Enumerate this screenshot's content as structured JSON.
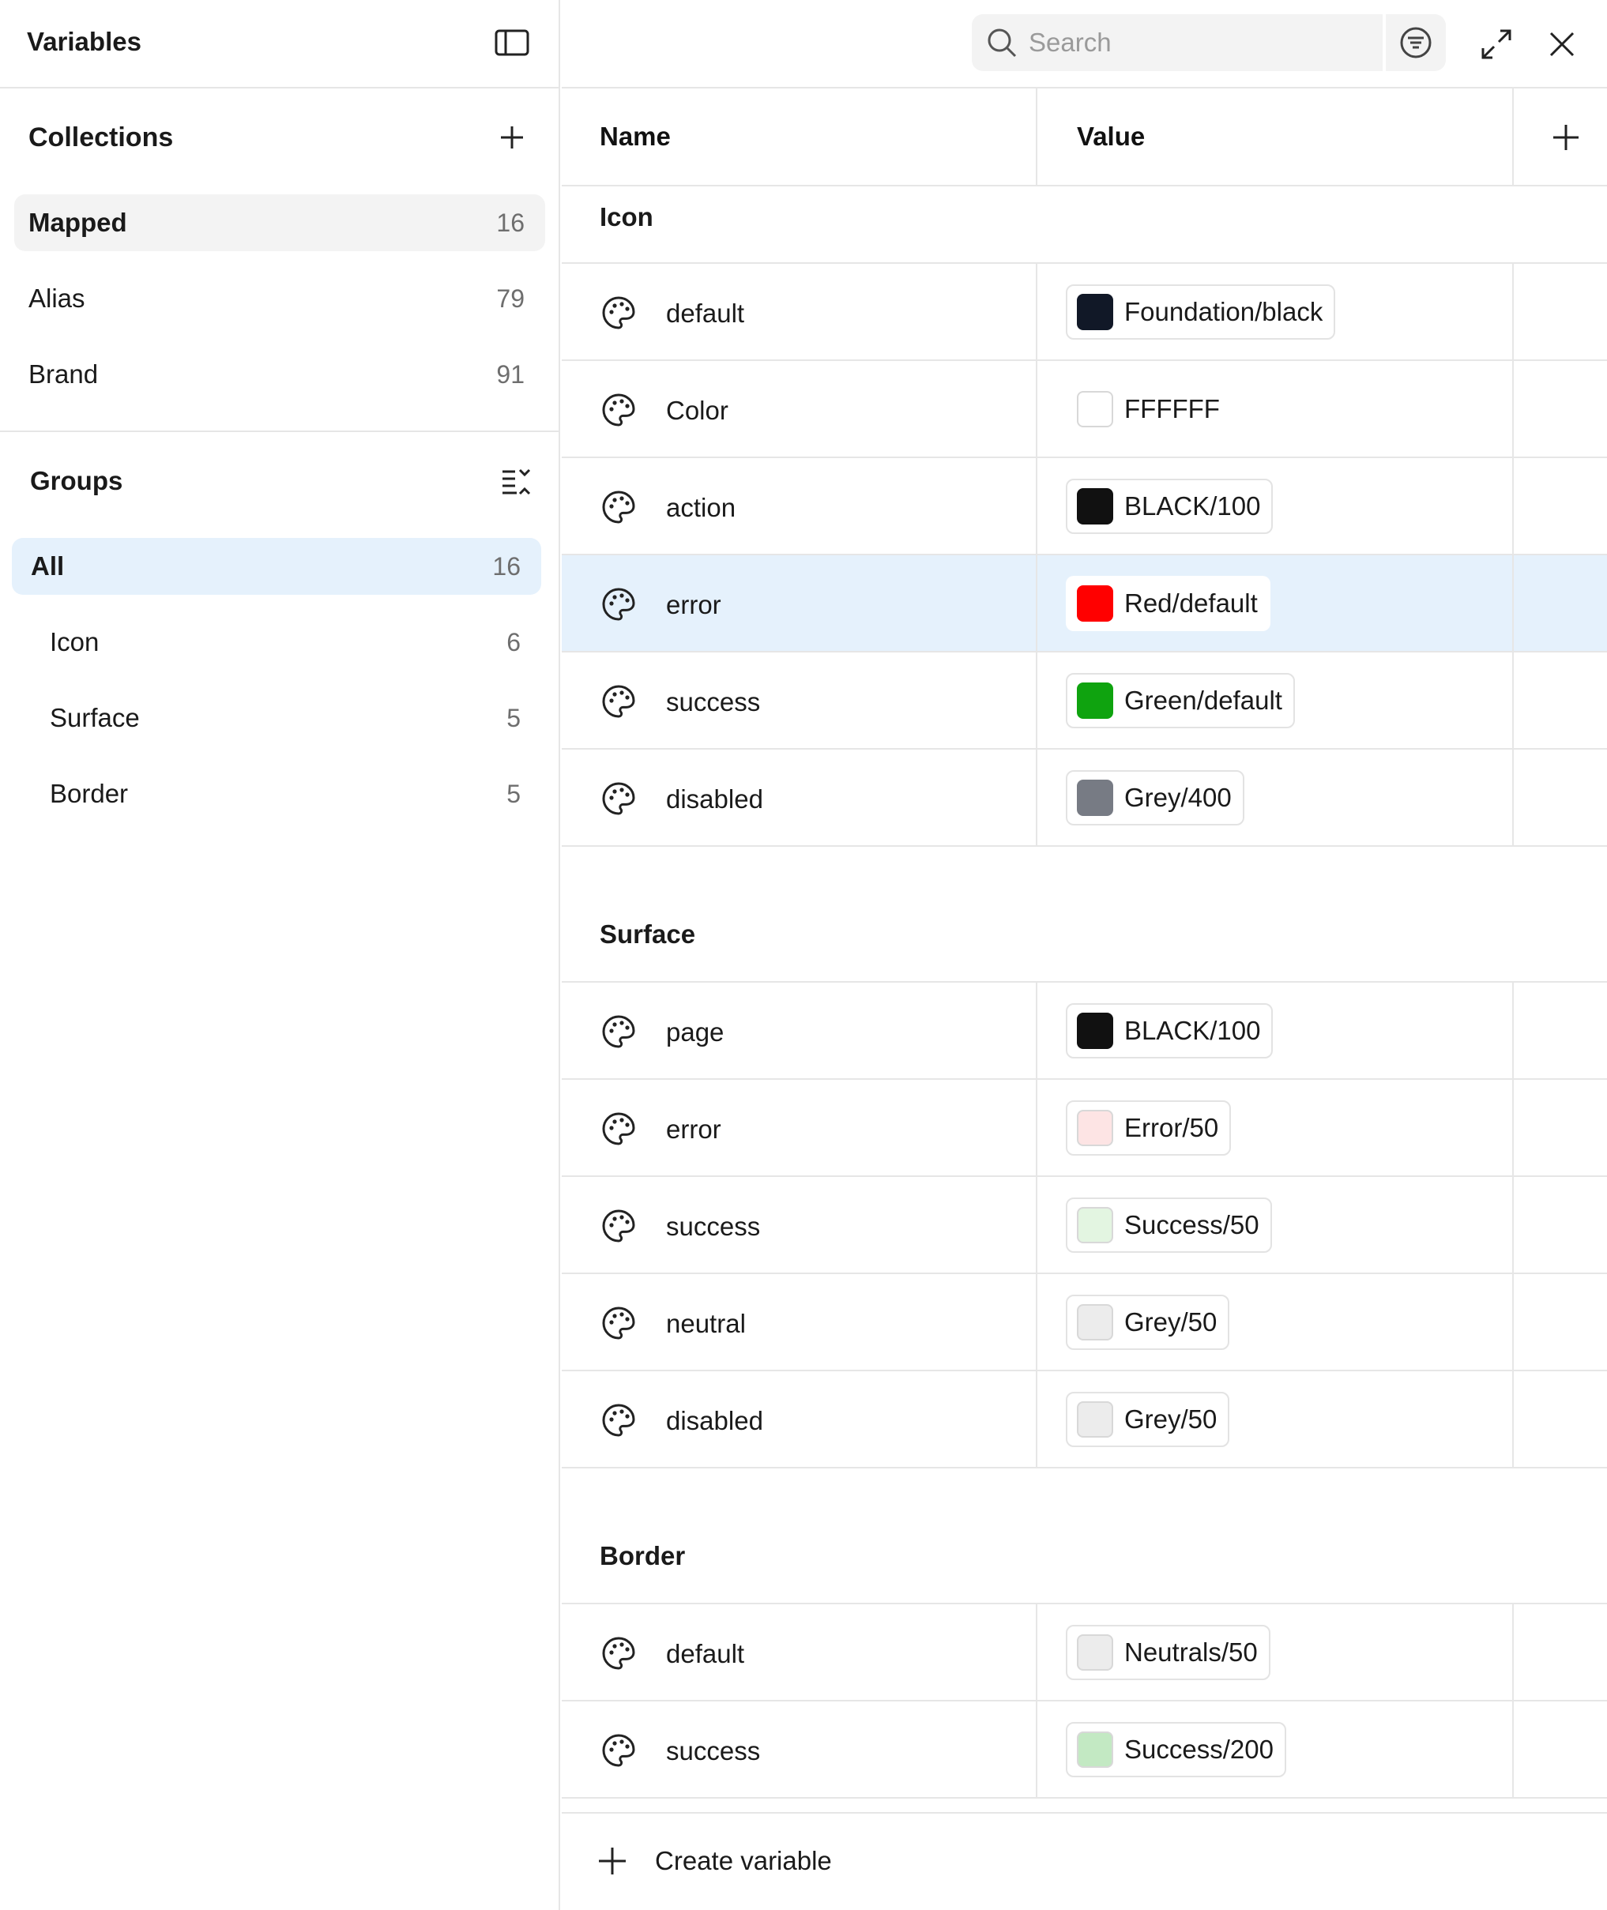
{
  "sidebar": {
    "title": "Variables",
    "collections": {
      "title": "Collections",
      "items": [
        {
          "label": "Mapped",
          "count": "16"
        },
        {
          "label": "Alias",
          "count": "79"
        },
        {
          "label": "Brand",
          "count": "91"
        }
      ]
    },
    "groups": {
      "title": "Groups",
      "items": [
        {
          "label": "All",
          "count": "16"
        },
        {
          "label": "Icon",
          "count": "6"
        },
        {
          "label": "Surface",
          "count": "5"
        },
        {
          "label": "Border",
          "count": "5"
        }
      ]
    }
  },
  "topbar": {
    "search_placeholder": "Search"
  },
  "table": {
    "col_name": "Name",
    "col_value": "Value",
    "groups": [
      {
        "title": "Icon",
        "rows": [
          {
            "name": "default",
            "value": "Foundation/black",
            "color": "#111827"
          },
          {
            "name": "Color",
            "value": "FFFFFF",
            "color": "#ffffff"
          },
          {
            "name": "action",
            "value": "BLACK/100",
            "color": "#111111"
          },
          {
            "name": "error",
            "value": "Red/default",
            "color": "#ff0000"
          },
          {
            "name": "success",
            "value": "Green/default",
            "color": "#0fa30f"
          },
          {
            "name": "disabled",
            "value": "Grey/400",
            "color": "#777b84"
          }
        ]
      },
      {
        "title": "Surface",
        "rows": [
          {
            "name": "page",
            "value": "BLACK/100",
            "color": "#111111"
          },
          {
            "name": "error",
            "value": "Error/50",
            "color": "#fde4e4"
          },
          {
            "name": "success",
            "value": "Success/50",
            "color": "#e3f5e1"
          },
          {
            "name": "neutral",
            "value": "Grey/50",
            "color": "#ececec"
          },
          {
            "name": "disabled",
            "value": "Grey/50",
            "color": "#ececec"
          }
        ]
      },
      {
        "title": "Border",
        "rows": [
          {
            "name": "default",
            "value": "Neutrals/50",
            "color": "#ececec"
          },
          {
            "name": "success",
            "value": "Success/200",
            "color": "#c3e9c3"
          }
        ]
      }
    ]
  },
  "footer": {
    "create_label": "Create variable"
  }
}
